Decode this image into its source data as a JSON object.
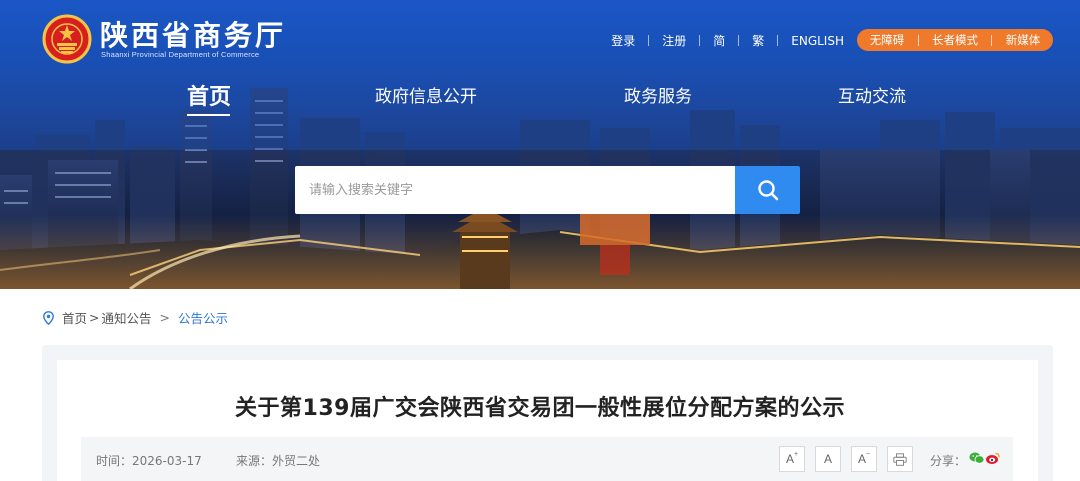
{
  "header": {
    "site_title": "陕西省商务厅",
    "site_subtitle": "Shaanxi Provincial Department of Commerce",
    "top_links": [
      "登录",
      "注册",
      "简",
      "繁",
      "ENGLISH"
    ],
    "accessibility": [
      "无障碍",
      "长者模式",
      "新媒体"
    ]
  },
  "nav": {
    "items": [
      "首页",
      "政府信息公开",
      "政务服务",
      "互动交流"
    ],
    "active": "首页"
  },
  "search": {
    "placeholder": "请输入搜索关键字"
  },
  "breadcrumb": {
    "home": "首页",
    "sep1": ">",
    "section": "通知公告",
    "sep2": ">",
    "current": "公告公示"
  },
  "article": {
    "title": "关于第139届广交会陕西省交易团一般性展位分配方案的公示",
    "time": "时间：2026-03-17",
    "source": "来源：外贸二处",
    "font_increase": "A",
    "font_normal": "A",
    "font_decrease": "A",
    "share_label": "分享："
  },
  "colors": {
    "banner_blue": "#1b57c6",
    "accent_orange": "#f07a2c",
    "search_button": "#2f8bf0",
    "link_blue": "#2f79d8"
  },
  "icons": {
    "emblem": "national-emblem-icon",
    "search": "search-icon",
    "location": "location-pin-icon",
    "print": "printer-icon",
    "wechat": "wechat-icon",
    "weibo": "weibo-icon"
  }
}
